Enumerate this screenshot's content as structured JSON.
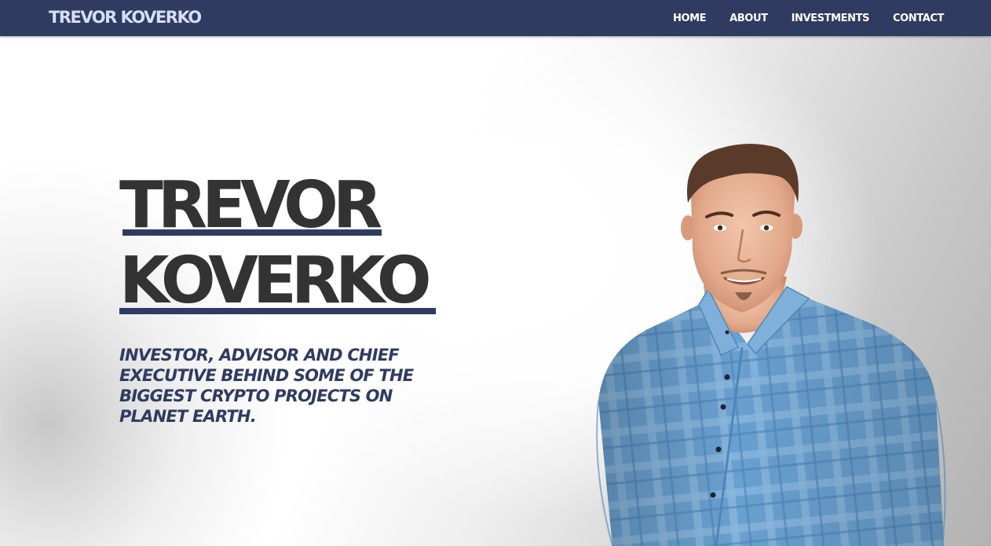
{
  "navbar": {
    "brand": "TREVOR KOVERKO",
    "links": [
      "HOME",
      "ABOUT",
      "INVESTMENTS",
      "CONTACT"
    ]
  },
  "hero": {
    "title_line1": "TREVOR",
    "title_line2": "KOVERKO",
    "tagline": "INVESTOR, ADVISOR AND CHIEF EXECUTIVE BEHIND SOME OF THE BIGGEST CRYPTO PROJECTS ON PLANET EARTH."
  },
  "colors": {
    "navbar": "#2f3b60",
    "brand_text": "#d5def8",
    "title_text": "#333333",
    "accent": "#2f3b60",
    "shirt": "#6aa0cf"
  },
  "portrait": {
    "icon": "person-portrait-photo"
  }
}
